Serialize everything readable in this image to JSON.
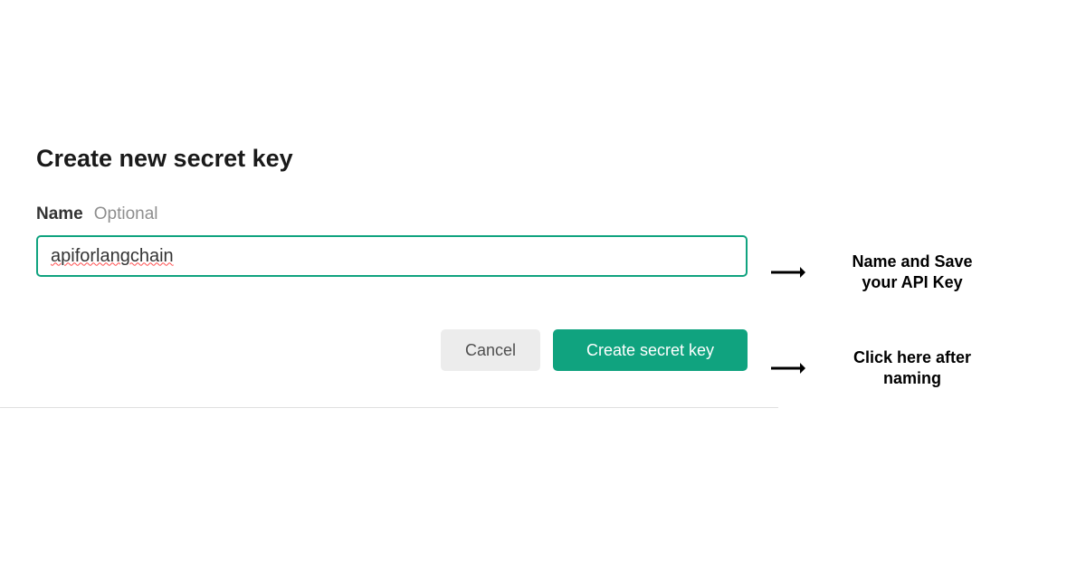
{
  "dialog": {
    "title": "Create new secret key",
    "field": {
      "label": "Name",
      "hint": "Optional",
      "value": "apiforlangchain"
    },
    "buttons": {
      "cancel": "Cancel",
      "create": "Create secret key"
    }
  },
  "annotations": {
    "top": "Name and Save\nyour API Key",
    "bottom": "Click here after\nnaming"
  }
}
